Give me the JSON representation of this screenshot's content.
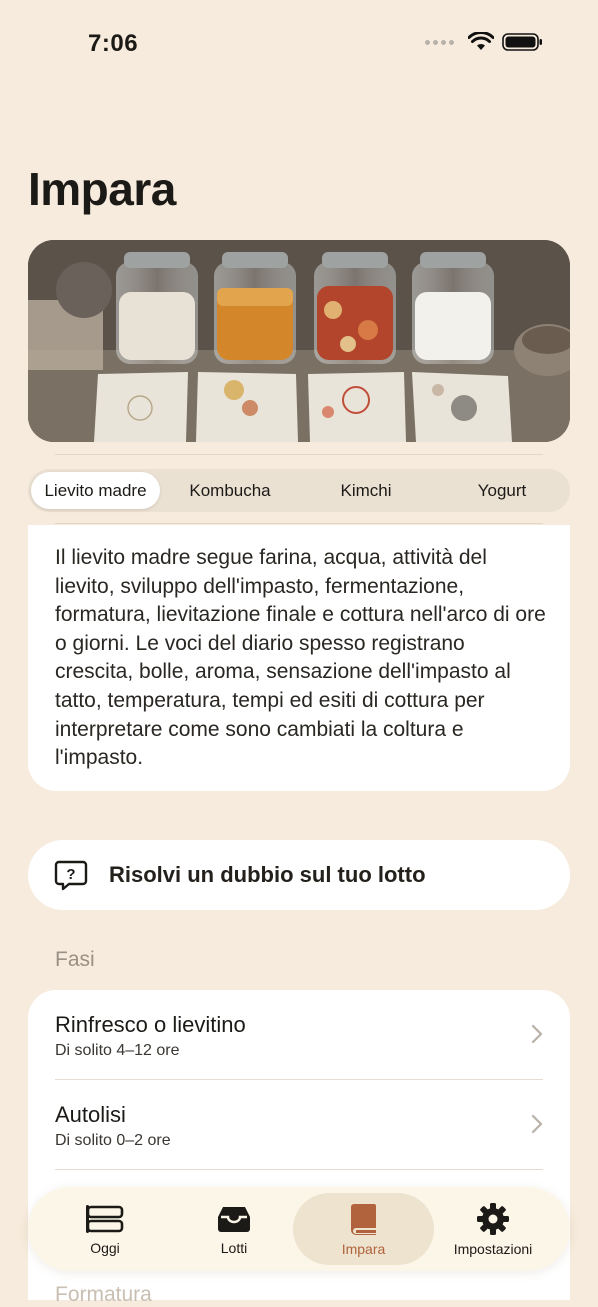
{
  "status_bar": {
    "time": "7:06"
  },
  "page": {
    "title": "Impara"
  },
  "hero_image": {
    "alt": "jars-of-ferments"
  },
  "segments": {
    "items": [
      "Lievito madre",
      "Kombucha",
      "Kimchi",
      "Yogurt"
    ],
    "selected": "Lievito madre"
  },
  "info": {
    "text": "Il lievito madre segue farina, acqua, attività del lievito, sviluppo dell'impasto, fermentazione, formatura, lievitazione finale e cottura nell'arco di ore o giorni. Le voci del diario spesso registrano crescita, bolle, aroma, sensazione dell'impasto al tatto, temperatura, tempi ed esiti di cottura per interpretare come sono cambiati la coltura e l'impasto."
  },
  "help": {
    "label": "Risolvi un dubbio sul tuo lotto",
    "icon": "question-bubble-icon"
  },
  "phases": {
    "label": "Fasi",
    "items": [
      {
        "title": "Rinfresco o lievitino",
        "subtitle": "Di solito 4–12 ore"
      },
      {
        "title": "Autolisi",
        "subtitle": "Di solito 0–2 ore"
      }
    ]
  },
  "next_section": {
    "label": "Formatura"
  },
  "tab_bar": {
    "items": [
      {
        "label": "Oggi",
        "icon": "today-icon"
      },
      {
        "label": "Lotti",
        "icon": "tray-icon"
      },
      {
        "label": "Impara",
        "icon": "book-icon"
      },
      {
        "label": "Impostazioni",
        "icon": "gear-icon"
      }
    ],
    "active": "Impara"
  },
  "colors": {
    "background": "#f6ebdc",
    "card": "#ffffff",
    "accent": "#b0633c",
    "muted": "#9a9086"
  }
}
